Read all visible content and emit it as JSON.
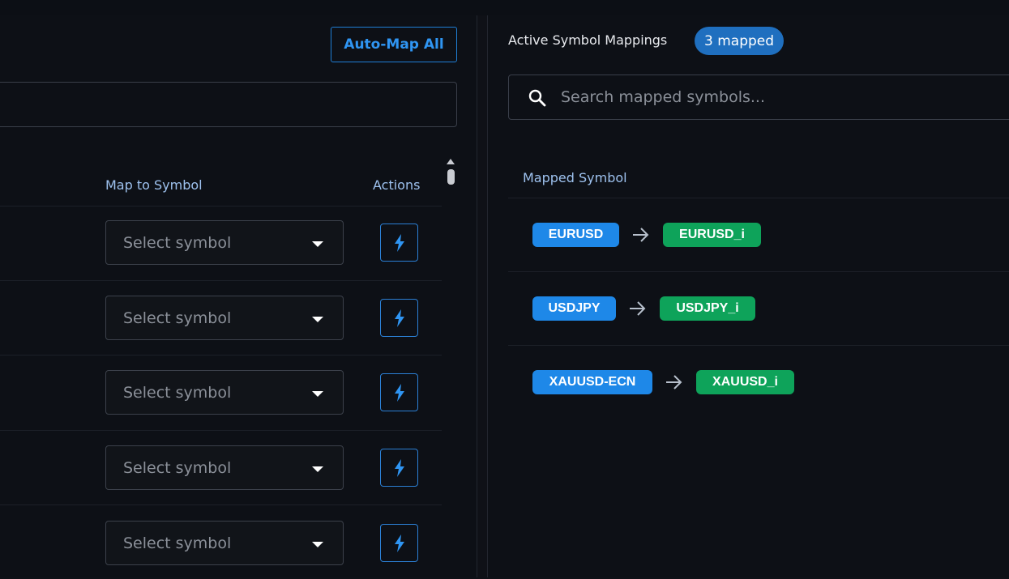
{
  "left": {
    "auto_map_label": "Auto-Map All",
    "headers": {
      "map_to_symbol": "Map to Symbol",
      "actions": "Actions"
    },
    "rows": [
      {
        "placeholder": "Select symbol"
      },
      {
        "placeholder": "Select symbol"
      },
      {
        "placeholder": "Select symbol"
      },
      {
        "placeholder": "Select symbol"
      },
      {
        "placeholder": "Select symbol"
      }
    ],
    "action_icon": "lightning-icon"
  },
  "right": {
    "title": "Active Symbol Mappings",
    "count_badge": "3 mapped",
    "search": {
      "placeholder": "Search mapped symbols...",
      "value": ""
    },
    "column_header": "Mapped Symbol",
    "mappings": [
      {
        "source": "EURUSD",
        "target": "EURUSD_i"
      },
      {
        "source": "USDJPY",
        "target": "USDJPY_i"
      },
      {
        "source": "XAUUSD-ECN",
        "target": "XAUUSD_i"
      }
    ]
  },
  "colors": {
    "accent": "#2f95f2",
    "source_pill": "#1e88e8",
    "target_pill": "#0ea35a",
    "badge": "#1f6fbf",
    "header_text": "#9ec2ef",
    "background": "#0d1016"
  }
}
